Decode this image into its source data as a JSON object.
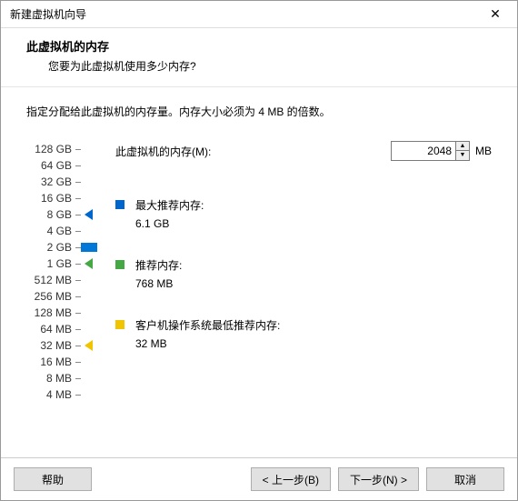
{
  "window": {
    "title": "新建虚拟机向导"
  },
  "header": {
    "title": "此虚拟机的内存",
    "subtitle": "您要为此虚拟机使用多少内存?"
  },
  "instruction": "指定分配给此虚拟机的内存量。内存大小必须为 4 MB 的倍数。",
  "memory": {
    "label": "此虚拟机的内存(M):",
    "value": "2048",
    "unit": "MB"
  },
  "ticks": [
    "128 GB",
    "64 GB",
    "32 GB",
    "16 GB",
    "8 GB",
    "4 GB",
    "2 GB",
    "1 GB",
    "512 MB",
    "256 MB",
    "128 MB",
    "64 MB",
    "32 MB",
    "16 MB",
    "8 MB",
    "4 MB"
  ],
  "markers": {
    "max": {
      "tick_index": 4,
      "color": "blue"
    },
    "rec": {
      "tick_index": 7,
      "color": "green"
    },
    "min": {
      "tick_index": 12,
      "color": "yellow"
    }
  },
  "slider_thumb_tick_index": 6,
  "recommendations": {
    "max": {
      "label": "最大推荐内存:",
      "value": "6.1 GB"
    },
    "rec": {
      "label": "推荐内存:",
      "value": "768 MB"
    },
    "min": {
      "label": "客户机操作系统最低推荐内存:",
      "value": "32 MB"
    }
  },
  "buttons": {
    "help": "帮助",
    "back": "< 上一步(B)",
    "next": "下一步(N) >",
    "cancel": "取消"
  }
}
